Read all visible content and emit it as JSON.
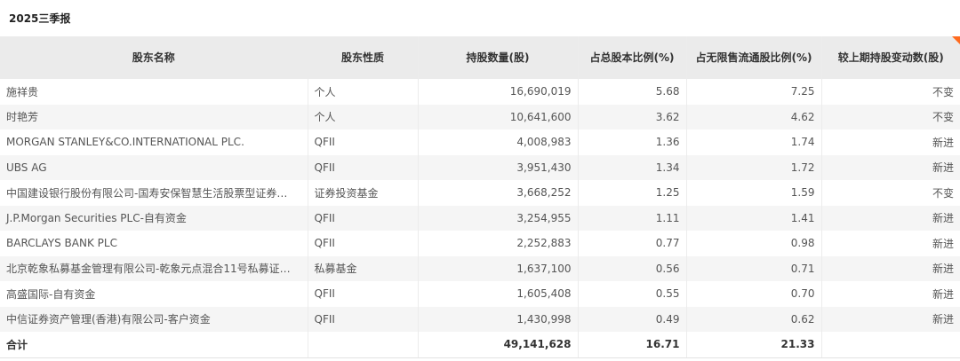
{
  "period": "2025三季报",
  "headers": {
    "name": "股东名称",
    "type": "股东性质",
    "shares": "持股数量(股)",
    "pct_total": "占总股本比例(%)",
    "pct_float": "占无限售流通股比例(%)",
    "change": "较上期持股变动数(股)"
  },
  "rows": [
    {
      "name": "施祥贵",
      "type": "个人",
      "shares": "16,690,019",
      "pct_total": "5.68",
      "pct_float": "7.25",
      "change": "不变"
    },
    {
      "name": "时艳芳",
      "type": "个人",
      "shares": "10,641,600",
      "pct_total": "3.62",
      "pct_float": "4.62",
      "change": "不变"
    },
    {
      "name": "MORGAN STANLEY&CO.INTERNATIONAL PLC.",
      "type": "QFII",
      "shares": "4,008,983",
      "pct_total": "1.36",
      "pct_float": "1.74",
      "change": "新进"
    },
    {
      "name": "UBS AG",
      "type": "QFII",
      "shares": "3,951,430",
      "pct_total": "1.34",
      "pct_float": "1.72",
      "change": "新进"
    },
    {
      "name": "中国建设银行股份有限公司-国寿安保智慧生活股票型证券…",
      "type": "证券投资基金",
      "shares": "3,668,252",
      "pct_total": "1.25",
      "pct_float": "1.59",
      "change": "不变"
    },
    {
      "name": "J.P.Morgan Securities PLC-自有资金",
      "type": "QFII",
      "shares": "3,254,955",
      "pct_total": "1.11",
      "pct_float": "1.41",
      "change": "新进"
    },
    {
      "name": "BARCLAYS BANK PLC",
      "type": "QFII",
      "shares": "2,252,883",
      "pct_total": "0.77",
      "pct_float": "0.98",
      "change": "新进"
    },
    {
      "name": "北京乾象私募基金管理有限公司-乾象元点混合11号私募证…",
      "type": "私募基金",
      "shares": "1,637,100",
      "pct_total": "0.56",
      "pct_float": "0.71",
      "change": "新进"
    },
    {
      "name": "高盛国际-自有资金",
      "type": "QFII",
      "shares": "1,605,408",
      "pct_total": "0.55",
      "pct_float": "0.70",
      "change": "新进"
    },
    {
      "name": "中信证券资产管理(香港)有限公司-客户资金",
      "type": "QFII",
      "shares": "1,430,998",
      "pct_total": "0.49",
      "pct_float": "0.62",
      "change": "新进"
    }
  ],
  "total": {
    "label": "合计",
    "shares": "49,141,628",
    "pct_total": "16.71",
    "pct_float": "21.33"
  },
  "colors": {
    "header_bg": "#ebebeb",
    "stripe_bg": "#f5f5f5",
    "corner_accent": "#ff6a1e"
  }
}
